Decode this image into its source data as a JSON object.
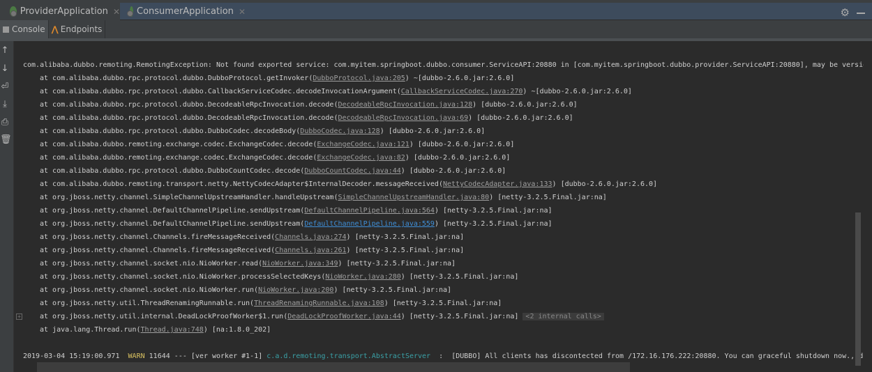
{
  "run_tabs": [
    {
      "label": "ProviderApplication"
    },
    {
      "label": "ConsumerApplication"
    }
  ],
  "sub_tabs": [
    {
      "label": "Console"
    },
    {
      "label": "Endpoints"
    }
  ],
  "console": {
    "exception": "com.alibaba.dubbo.remoting.RemotingException: Not found exported service: com.myitem.springboot.dubbo.consumer.ServiceAPI:20880 in [com.myitem.springboot.dubbo.provider.ServiceAPI:20880], may be version",
    "frames": [
      {
        "m": "at com.alibaba.dubbo.rpc.protocol.dubbo.DubboProtocol.getInvoker",
        "link": "DubboProtocol.java:205",
        "tail": " ~[dubbo-2.6.0.jar:2.6.0]"
      },
      {
        "m": "at com.alibaba.dubbo.rpc.protocol.dubbo.CallbackServiceCodec.decodeInvocationArgument",
        "link": "CallbackServiceCodec.java:270",
        "tail": " ~[dubbo-2.6.0.jar:2.6.0]"
      },
      {
        "m": "at com.alibaba.dubbo.rpc.protocol.dubbo.DecodeableRpcInvocation.decode",
        "link": "DecodeableRpcInvocation.java:128",
        "tail": " [dubbo-2.6.0.jar:2.6.0]"
      },
      {
        "m": "at com.alibaba.dubbo.rpc.protocol.dubbo.DecodeableRpcInvocation.decode",
        "link": "DecodeableRpcInvocation.java:69",
        "tail": " [dubbo-2.6.0.jar:2.6.0]"
      },
      {
        "m": "at com.alibaba.dubbo.rpc.protocol.dubbo.DubboCodec.decodeBody",
        "link": "DubboCodec.java:128",
        "tail": " [dubbo-2.6.0.jar:2.6.0]"
      },
      {
        "m": "at com.alibaba.dubbo.remoting.exchange.codec.ExchangeCodec.decode",
        "link": "ExchangeCodec.java:121",
        "tail": " [dubbo-2.6.0.jar:2.6.0]"
      },
      {
        "m": "at com.alibaba.dubbo.remoting.exchange.codec.ExchangeCodec.decode",
        "link": "ExchangeCodec.java:82",
        "tail": " [dubbo-2.6.0.jar:2.6.0]"
      },
      {
        "m": "at com.alibaba.dubbo.rpc.protocol.dubbo.DubboCountCodec.decode",
        "link": "DubboCountCodec.java:44",
        "tail": " [dubbo-2.6.0.jar:2.6.0]"
      },
      {
        "m": "at com.alibaba.dubbo.remoting.transport.netty.NettyCodecAdapter$InternalDecoder.messageReceived",
        "link": "NettyCodecAdapter.java:133",
        "tail": " [dubbo-2.6.0.jar:2.6.0]"
      },
      {
        "m": "at org.jboss.netty.channel.SimpleChannelUpstreamHandler.handleUpstream",
        "link": "SimpleChannelUpstreamHandler.java:80",
        "tail": " [netty-3.2.5.Final.jar:na]"
      },
      {
        "m": "at org.jboss.netty.channel.DefaultChannelPipeline.sendUpstream",
        "link": "DefaultChannelPipeline.java:564",
        "tail": " [netty-3.2.5.Final.jar:na]"
      },
      {
        "m": "at org.jboss.netty.channel.DefaultChannelPipeline.sendUpstream",
        "link": "DefaultChannelPipeline.java:559",
        "tail": " [netty-3.2.5.Final.jar:na]",
        "hot": true
      },
      {
        "m": "at org.jboss.netty.channel.Channels.fireMessageReceived",
        "link": "Channels.java:274",
        "tail": " [netty-3.2.5.Final.jar:na]"
      },
      {
        "m": "at org.jboss.netty.channel.Channels.fireMessageReceived",
        "link": "Channels.java:261",
        "tail": " [netty-3.2.5.Final.jar:na]"
      },
      {
        "m": "at org.jboss.netty.channel.socket.nio.NioWorker.read",
        "link": "NioWorker.java:349",
        "tail": " [netty-3.2.5.Final.jar:na]"
      },
      {
        "m": "at org.jboss.netty.channel.socket.nio.NioWorker.processSelectedKeys",
        "link": "NioWorker.java:280",
        "tail": " [netty-3.2.5.Final.jar:na]"
      },
      {
        "m": "at org.jboss.netty.channel.socket.nio.NioWorker.run",
        "link": "NioWorker.java:200",
        "tail": " [netty-3.2.5.Final.jar:na]"
      },
      {
        "m": "at org.jboss.netty.util.ThreadRenamingRunnable.run",
        "link": "ThreadRenamingRunnable.java:108",
        "tail": " [netty-3.2.5.Final.jar:na]"
      },
      {
        "m": "at org.jboss.netty.util.internal.DeadLockProofWorker$1.run",
        "link": "DeadLockProofWorker.java:44",
        "tail": " [netty-3.2.5.Final.jar:na]",
        "internal": "<2 internal calls>"
      },
      {
        "m": "at java.lang.Thread.run",
        "link": "Thread.java:748",
        "tail": " [na:1.8.0_202]"
      }
    ],
    "log": {
      "time": "2019-03-04 15:19:00.971",
      "level": "WARN",
      "pid": "11644",
      "sep": "---",
      "thread": "[ver worker #1-1]",
      "logger": "c.a.d.remoting.transport.AbstractServer",
      "colon": ":",
      "msg": "[DUBBO] All clients has discontected from /172.16.176.222:20880. You can graceful shutdown now., dubb"
    }
  }
}
